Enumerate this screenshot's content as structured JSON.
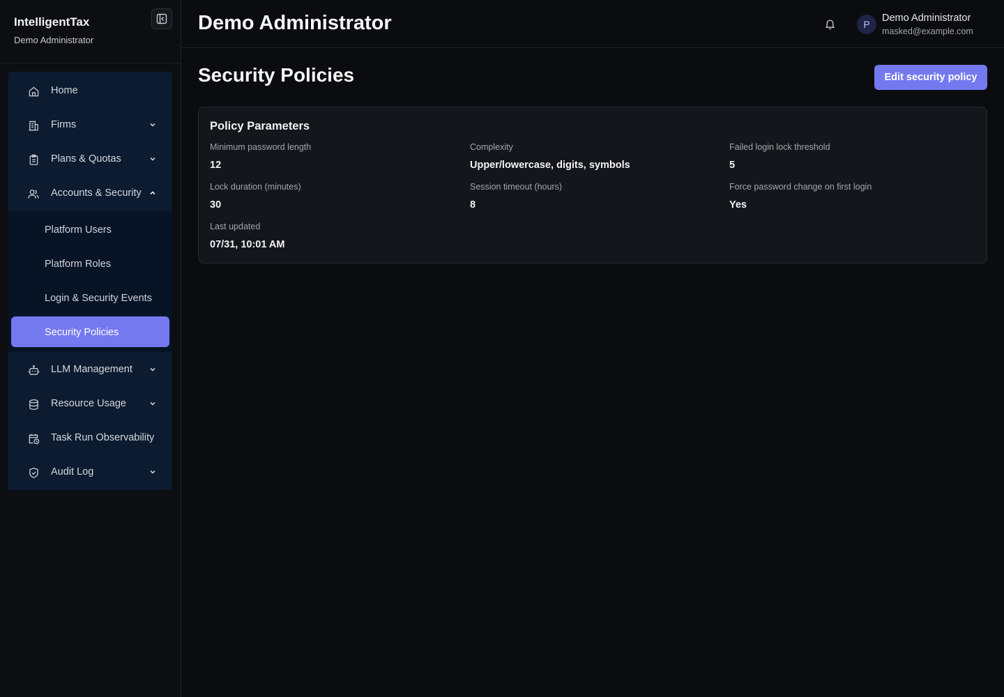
{
  "brand": {
    "name": "IntelligentTax",
    "subtitle": "Demo Administrator"
  },
  "sidebar": {
    "items": [
      {
        "label": "Home",
        "icon": "home-icon",
        "has_chevron": false
      },
      {
        "label": "Firms",
        "icon": "building-icon",
        "has_chevron": true
      },
      {
        "label": "Plans & Quotas",
        "icon": "clipboard-icon",
        "has_chevron": true
      },
      {
        "label": "Accounts & Security",
        "icon": "users-icon",
        "has_chevron": true,
        "expanded": true
      },
      {
        "label": "LLM Management",
        "icon": "robot-icon",
        "has_chevron": true
      },
      {
        "label": "Resource Usage",
        "icon": "database-icon",
        "has_chevron": true
      },
      {
        "label": "Task Run Observability",
        "icon": "calendar-clock-icon",
        "has_chevron": false
      },
      {
        "label": "Audit Log",
        "icon": "shield-check-icon",
        "has_chevron": true
      }
    ],
    "subitems": [
      {
        "label": "Platform Users",
        "active": false
      },
      {
        "label": "Platform Roles",
        "active": false
      },
      {
        "label": "Login & Security Events",
        "active": false
      },
      {
        "label": "Security Policies",
        "active": true
      }
    ]
  },
  "header": {
    "title": "Demo Administrator",
    "user": {
      "initial": "P",
      "name": "Demo Administrator",
      "email": "masked@example.com"
    }
  },
  "main": {
    "title": "Security Policies",
    "edit_button": "Edit security policy",
    "card": {
      "title": "Policy Parameters",
      "fields": [
        {
          "label": "Minimum password length",
          "value": "12"
        },
        {
          "label": "Complexity",
          "value": "Upper/lowercase, digits, symbols"
        },
        {
          "label": "Failed login lock threshold",
          "value": "5"
        },
        {
          "label": "Lock duration (minutes)",
          "value": "30"
        },
        {
          "label": "Session timeout (hours)",
          "value": "8"
        },
        {
          "label": "Force password change on first login",
          "value": "Yes"
        },
        {
          "label": "Last updated",
          "value": "07/31, 10:01 AM"
        }
      ]
    }
  },
  "colors": {
    "accent": "#7479f0",
    "background": "#0b0c0f",
    "nav_background": "#0c1b30",
    "card_background": "#14161b"
  }
}
